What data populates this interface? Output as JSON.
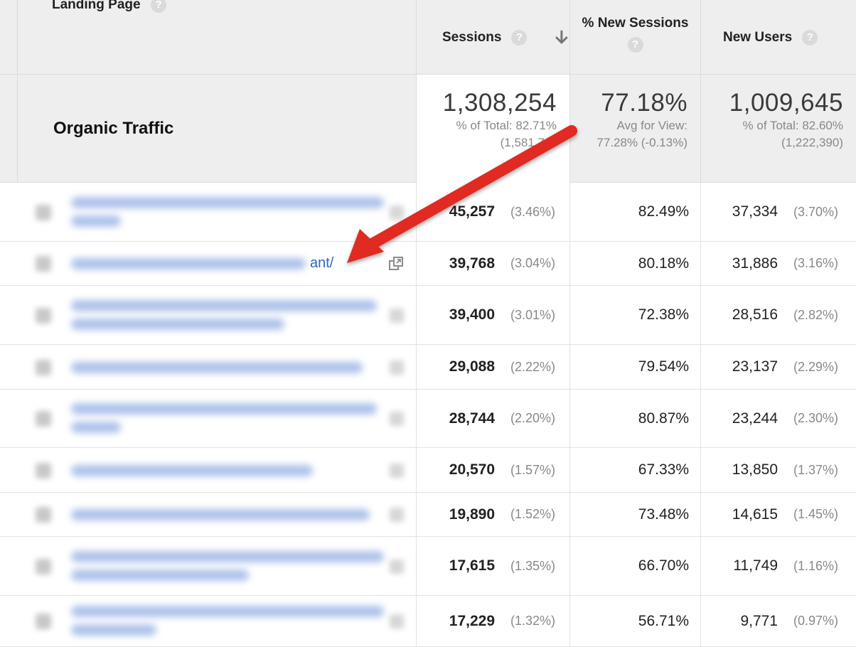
{
  "columns": {
    "landing_page": "Landing Page",
    "sessions": "Sessions",
    "new_sessions": "% New Sessions",
    "new_users": "New Users",
    "help_glyph": "?",
    "sort_icon": "arrow-down-icon"
  },
  "summary": {
    "label": "Organic Traffic",
    "sessions": "1,308,254",
    "sessions_sub1": "% of Total: 82.71%",
    "sessions_sub2": "(1,581,7…",
    "new_sessions": "77.18%",
    "new_sessions_sub1": "Avg for View:",
    "new_sessions_sub2": "77.28% (-0.13%)",
    "new_users": "1,009,645",
    "new_users_sub1": "% of Total: 82.60%",
    "new_users_sub2": "(1,222,390)"
  },
  "rows": [
    {
      "sessions": "45,257",
      "sessions_pct": "(3.46%)",
      "new_sessions": "82.49%",
      "new_users": "37,334",
      "new_users_pct": "(3.70%)"
    },
    {
      "link_tail": "ant/",
      "sessions": "39,768",
      "sessions_pct": "(3.04%)",
      "new_sessions": "80.18%",
      "new_users": "31,886",
      "new_users_pct": "(3.16%)"
    },
    {
      "sessions": "39,400",
      "sessions_pct": "(3.01%)",
      "new_sessions": "72.38%",
      "new_users": "28,516",
      "new_users_pct": "(2.82%)"
    },
    {
      "sessions": "29,088",
      "sessions_pct": "(2.22%)",
      "new_sessions": "79.54%",
      "new_users": "23,137",
      "new_users_pct": "(2.29%)"
    },
    {
      "sessions": "28,744",
      "sessions_pct": "(2.20%)",
      "new_sessions": "80.87%",
      "new_users": "23,244",
      "new_users_pct": "(2.30%)"
    },
    {
      "sessions": "20,570",
      "sessions_pct": "(1.57%)",
      "new_sessions": "67.33%",
      "new_users": "13,850",
      "new_users_pct": "(1.37%)"
    },
    {
      "sessions": "19,890",
      "sessions_pct": "(1.52%)",
      "new_sessions": "73.48%",
      "new_users": "14,615",
      "new_users_pct": "(1.45%)"
    },
    {
      "sessions": "17,615",
      "sessions_pct": "(1.35%)",
      "new_sessions": "66.70%",
      "new_users": "11,749",
      "new_users_pct": "(1.16%)"
    },
    {
      "sessions": "17,229",
      "sessions_pct": "(1.32%)",
      "new_sessions": "56.71%",
      "new_users": "9,771",
      "new_users_pct": "(0.97%)"
    }
  ],
  "annotation": {
    "arrow_color": "#e02b20",
    "icon": "red-arrow-icon"
  },
  "colors": {
    "header_bg": "#eeeeee",
    "link": "#2a66c4",
    "muted": "#888888"
  }
}
